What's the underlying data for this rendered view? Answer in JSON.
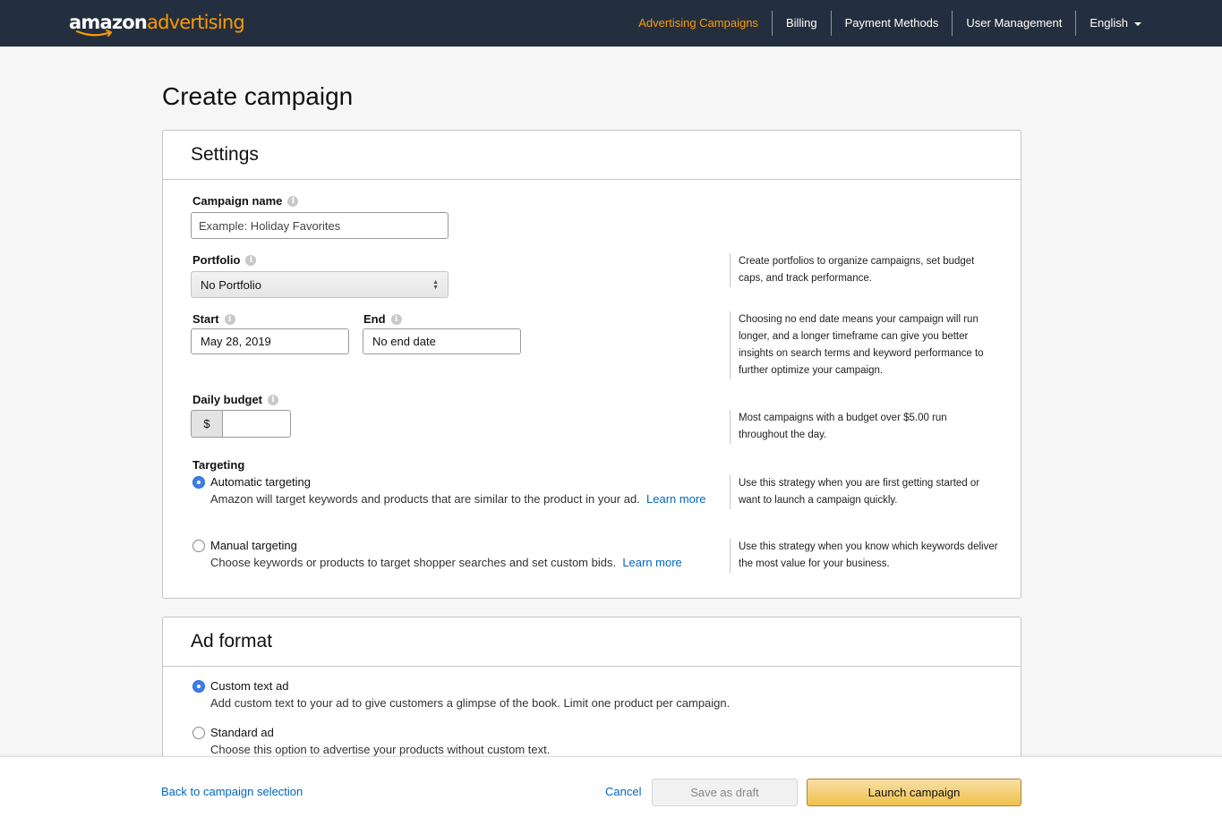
{
  "brand": {
    "logo_part1": "amazon",
    "logo_part2": "advertising",
    "accent_color": "#ff9900",
    "nav_bg": "#232f3e"
  },
  "nav": {
    "items": [
      {
        "label": "Advertising Campaigns",
        "active": true
      },
      {
        "label": "Billing"
      },
      {
        "label": "Payment Methods"
      },
      {
        "label": "User Management"
      },
      {
        "label": "English"
      }
    ]
  },
  "page": {
    "title": "Create campaign"
  },
  "settings": {
    "header": "Settings",
    "campaign_name": {
      "label": "Campaign name",
      "placeholder": "Example: Holiday Favorites",
      "value": ""
    },
    "portfolio": {
      "label": "Portfolio",
      "selected": "No Portfolio",
      "help": "Create portfolios to organize campaigns, set budget caps, and track performance."
    },
    "start": {
      "label": "Start",
      "value": "May 28, 2019"
    },
    "end": {
      "label": "End",
      "value": "No end date"
    },
    "dates_help": "Choosing no end date means your campaign will run longer, and a longer timeframe can give you better insights on search terms and keyword performance to further optimize your campaign.",
    "daily_budget": {
      "label": "Daily budget",
      "currency": "$",
      "value": "",
      "help": "Most campaigns with a budget over $5.00 run throughout the day."
    },
    "targeting": {
      "label": "Targeting",
      "automatic": {
        "title": "Automatic targeting",
        "desc": "Amazon will target keywords and products that are similar to the product in your ad.",
        "link": "Learn more",
        "checked": true,
        "help": "Use this strategy when you are first getting started or want to launch a campaign quickly."
      },
      "manual": {
        "title": "Manual targeting",
        "desc": "Choose keywords or products to target shopper searches and set custom bids.",
        "link": "Learn more",
        "checked": false,
        "help": "Use this strategy when you know which keywords deliver the most value for your business."
      }
    }
  },
  "ad_format": {
    "header": "Ad format",
    "custom": {
      "title": "Custom text ad",
      "desc": "Add custom text to your ad to give customers a glimpse of the book. Limit one product per campaign.",
      "checked": true
    },
    "standard": {
      "title": "Standard ad",
      "desc": "Choose this option to advertise your products without custom text.",
      "checked": false
    }
  },
  "footer": {
    "back": "Back to campaign selection",
    "cancel": "Cancel",
    "save_draft": "Save as draft",
    "launch": "Launch campaign"
  },
  "icons": {
    "info": "info-icon",
    "dropdown": "caret-down-icon",
    "select_arrows": "select-arrows-icon"
  }
}
